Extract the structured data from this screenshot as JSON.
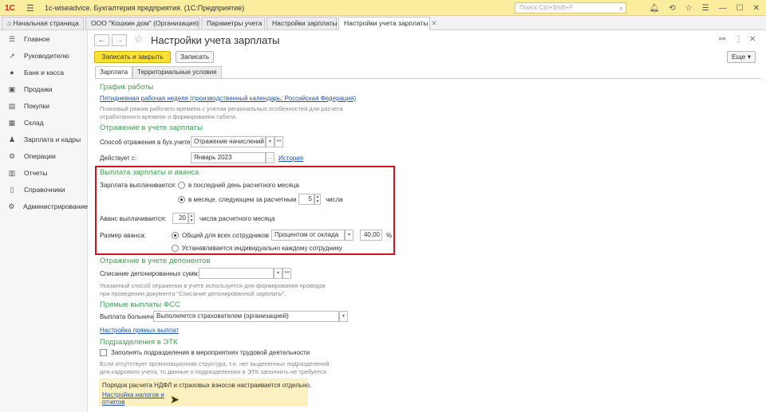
{
  "app": {
    "logo": "1С",
    "title": "1c-wiseadvice. Бухгалтерия предприятия.  (1С:Предприятие)",
    "search_placeholder": "Поиск Ctrl+Shift+F"
  },
  "tabs": [
    "Начальная страница",
    "ООО \"Кошкин дом\" (Организация)",
    "Параметры учета",
    "Настройки зарплаты",
    "Настройки учета зарплаты"
  ],
  "sidebar": [
    "Главное",
    "Руководителю",
    "Банк и касса",
    "Продажи",
    "Покупки",
    "Склад",
    "Зарплата и кадры",
    "Операции",
    "Отчеты",
    "Справочники",
    "Администрирование"
  ],
  "form": {
    "title": "Настройки учета зарплаты",
    "save_close": "Записать и закрыть",
    "save": "Записать",
    "more": "Еще",
    "form_tabs": [
      "Зарплата",
      "Территориальные условия"
    ]
  },
  "schedule": {
    "heading": "График работы",
    "link": "Пятидневная рабочая неделя (производственный календарь: Российская Федерация)",
    "hint1": "Плановый режим рабочего времени с учетом региональных особенностей для расчета",
    "hint2": "отработанного времени и формирования табеля."
  },
  "reflection": {
    "heading": "Отражение в учете зарплаты",
    "method_label": "Способ отражения в бух.учете:",
    "method_value": "Отражение начислений п",
    "date_label": "Действует с:",
    "date_value": "Январь 2023",
    "history": "История"
  },
  "payment": {
    "heading": "Выплата зарплаты и аванса",
    "paid_label": "Зарплата выплачивается:",
    "opt_last": "в последний день расчетного месяца",
    "opt_next": "в месяце, следующем за расчетным",
    "day_value": "5",
    "day_suffix": "числа",
    "advance_label": "Аванс выплачивается:",
    "advance_day": "20",
    "advance_suffix": "числа расчетного месяца",
    "size_label": "Размер аванса:",
    "opt_common": "Общий для всех сотрудников",
    "method_value": "Процентом от оклада",
    "percent_value": "40,00",
    "percent_sign": "%",
    "opt_individual": "Устанавливается индивидуально каждому сотруднику"
  },
  "deposit": {
    "heading": "Отражение в учете депонентов",
    "label": "Списание депонированных сумм:",
    "value": "",
    "hint1": "Указанный способ отражения в учете используется для формирования проводок",
    "hint2": "при проведении документа \"Списание депонированной зарплаты\"."
  },
  "fss": {
    "heading": "Прямые выплаты ФСС",
    "label": "Выплата больничных:",
    "value": "Выполняется страхователем (организацией)",
    "link": "Настройка прямых выплат"
  },
  "etk": {
    "heading": "Подразделения в ЭТК",
    "checkbox": "Заполнять подразделения в мероприятиях трудовой деятельности",
    "hint1": "Если отсутствует организационная структура, т.е. нет выделенных подразделений",
    "hint2": "для кадрового учета, то данные о подразделениях в ЭТК заполнять не требуется"
  },
  "notice": {
    "text": "Порядок расчета НДФЛ и страховых взносов настраивается отдельно.",
    "link1": "Настройка налогов и",
    "link2": "отчетов"
  }
}
